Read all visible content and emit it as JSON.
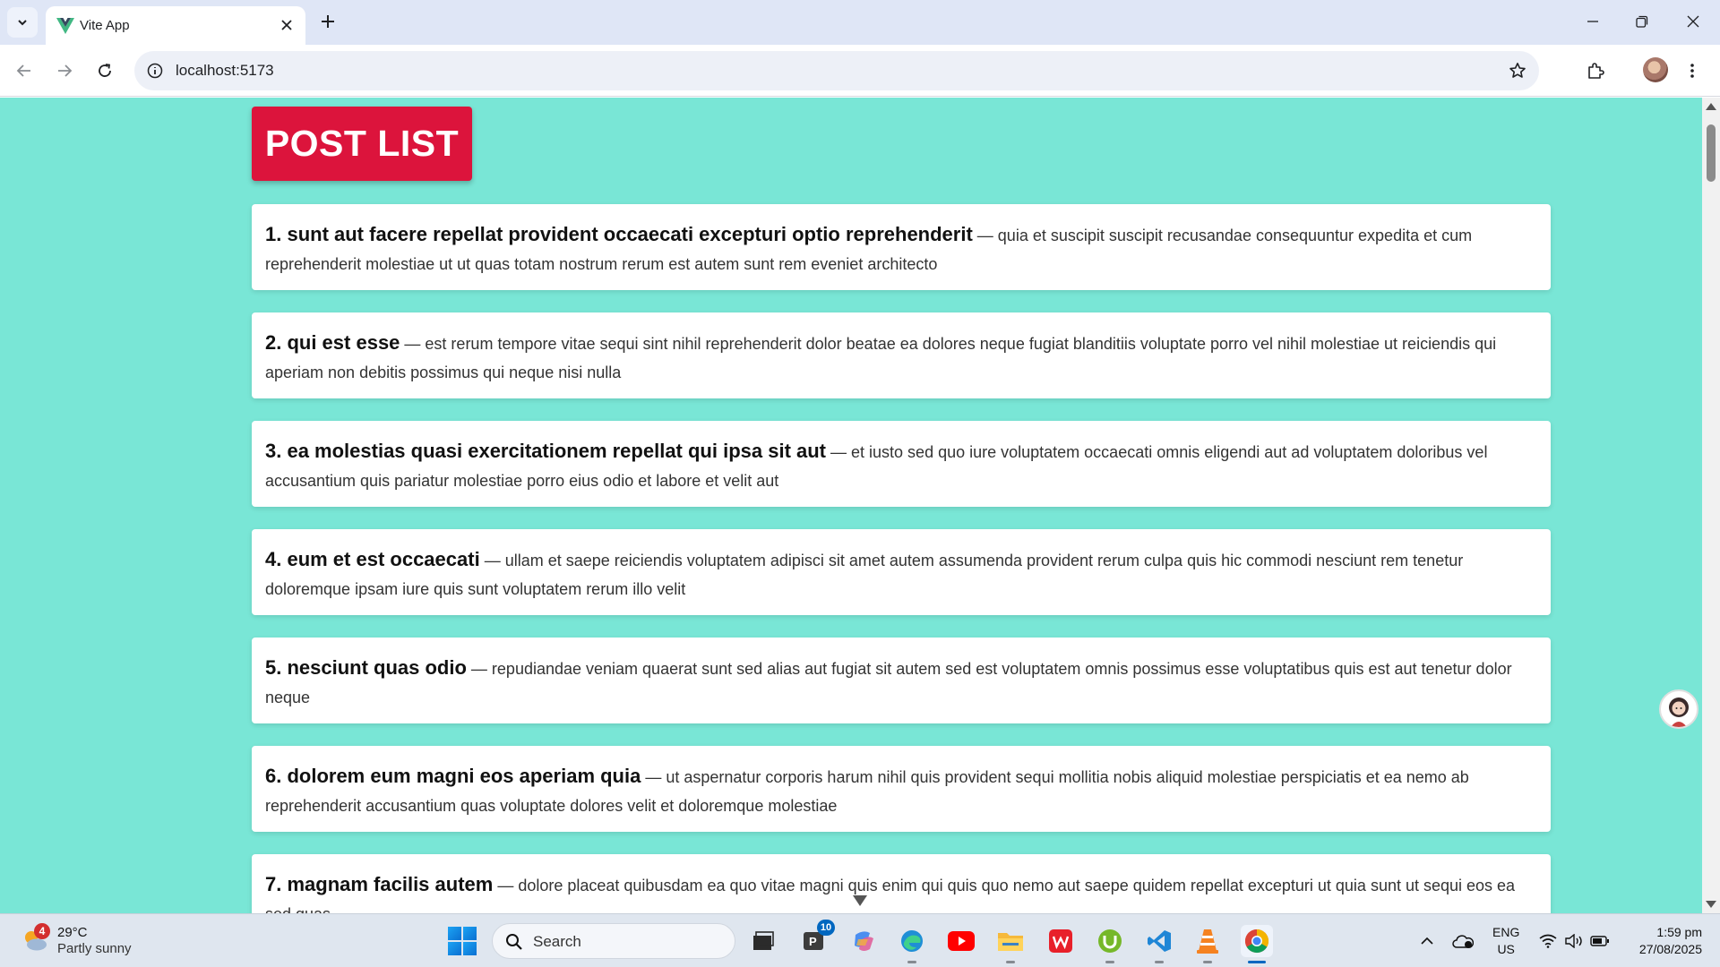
{
  "browser": {
    "tab_title": "Vite App",
    "url": "localhost:5173"
  },
  "page": {
    "heading": "POST LIST",
    "posts": [
      {
        "title": "1. sunt aut facere repellat provident occaecati excepturi optio reprehenderit",
        "body": " — quia et suscipit suscipit recusandae consequuntur expedita et cum reprehenderit molestiae ut ut quas totam nostrum rerum est autem sunt rem eveniet architecto"
      },
      {
        "title": "2. qui est esse",
        "body": " — est rerum tempore vitae sequi sint nihil reprehenderit dolor beatae ea dolores neque fugiat blanditiis voluptate porro vel nihil molestiae ut reiciendis qui aperiam non debitis possimus qui neque nisi nulla"
      },
      {
        "title": "3. ea molestias quasi exercitationem repellat qui ipsa sit aut",
        "body": " — et iusto sed quo iure voluptatem occaecati omnis eligendi aut ad voluptatem doloribus vel accusantium quis pariatur molestiae porro eius odio et labore et velit aut"
      },
      {
        "title": "4. eum et est occaecati",
        "body": " — ullam et saepe reiciendis voluptatem adipisci sit amet autem assumenda provident rerum culpa quis hic commodi nesciunt rem tenetur doloremque ipsam iure quis sunt voluptatem rerum illo velit"
      },
      {
        "title": "5. nesciunt quas odio",
        "body": " — repudiandae veniam quaerat sunt sed alias aut fugiat sit autem sed est voluptatem omnis possimus esse voluptatibus quis est aut tenetur dolor neque"
      },
      {
        "title": "6. dolorem eum magni eos aperiam quia",
        "body": " — ut aspernatur corporis harum nihil quis provident sequi mollitia nobis aliquid molestiae perspiciatis et ea nemo ab reprehenderit accusantium quas voluptate dolores velit et doloremque molestiae"
      },
      {
        "title": "7. magnam facilis autem",
        "body": " — dolore placeat quibusdam ea quo vitae magni quis enim qui quis quo nemo aut saepe quidem repellat excepturi ut quia sunt ut sequi eos ea sed quas"
      }
    ]
  },
  "taskbar": {
    "weather_badge": "4",
    "weather_temp": "29°C",
    "weather_desc": "Partly sunny",
    "search_placeholder": "Search",
    "app_badge": "10",
    "lang_top": "ENG",
    "lang_bottom": "US",
    "time": "1:59 pm",
    "date": "27/08/2025"
  },
  "colors": {
    "page_bg": "#79e6d6",
    "heading_bg": "#dc143c",
    "card_bg": "#ffffff"
  }
}
